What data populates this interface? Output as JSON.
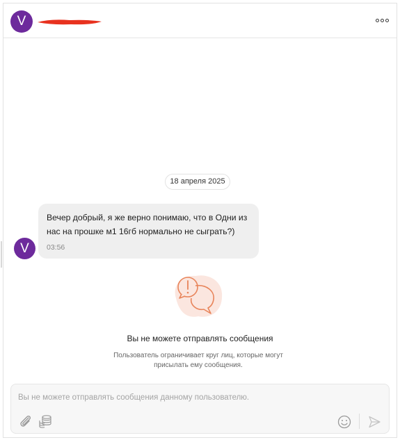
{
  "header": {
    "avatar_letter": "V",
    "more_label": "ooo"
  },
  "chat": {
    "date": "18 апреля 2025",
    "message": {
      "avatar_letter": "V",
      "text": "Вечер добрый, я же верно понимаю, что в Одни из нас на прошке м1 16гб нормально не сыграть?)",
      "time": "03:56"
    }
  },
  "blocked": {
    "title": "Вы не можете отправлять сообщения",
    "description": "Пользователь ограничивает круг лиц, которые могут присылать ему сообщения."
  },
  "composer": {
    "placeholder": "Вы не можете отправлять сообщения данному пользователю."
  },
  "colors": {
    "avatar": "#6d2a9c",
    "redaction": "#e8321f",
    "warning_icon": "#e8845a",
    "warning_bg": "#fbe6df"
  },
  "icons": [
    "more-icon",
    "warning-chat-icon",
    "paperclip-icon",
    "coins-icon",
    "emoji-icon",
    "send-icon"
  ]
}
